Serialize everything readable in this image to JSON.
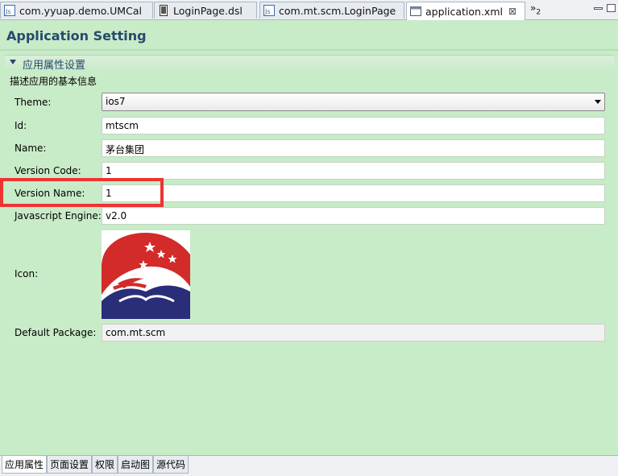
{
  "tabs": [
    {
      "label": "com.yyuap.demo.UMCal",
      "icon": "js-file-icon",
      "active": false
    },
    {
      "label": "LoginPage.dsl",
      "icon": "dsl-file-icon",
      "active": false
    },
    {
      "label": "com.mt.scm.LoginPage",
      "icon": "js-file-icon",
      "active": false
    },
    {
      "label": "application.xml",
      "icon": "xml-file-icon",
      "active": true,
      "close": "⊠"
    }
  ],
  "overflow": {
    "symbol": "»",
    "count": "2"
  },
  "form": {
    "title": "Application Setting",
    "section_title": "应用属性设置",
    "section_desc": "描述应用的基本信息",
    "fields": {
      "theme": {
        "label": "Theme:",
        "value": "ios7"
      },
      "id": {
        "label": "Id:",
        "value": "mtscm"
      },
      "name": {
        "label": "Name:",
        "value": "茅台集团"
      },
      "version_code": {
        "label": "Version Code:",
        "value": "1"
      },
      "version_name": {
        "label": "Version Name:",
        "value": "1"
      },
      "js_engine": {
        "label": "Javascript Engine:",
        "value": "v2.0"
      },
      "icon": {
        "label": "Icon:"
      },
      "default_package": {
        "label": "Default Package:",
        "value": "com.mt.scm"
      }
    }
  },
  "bottom_tabs": [
    {
      "label": "应用属性",
      "active": true
    },
    {
      "label": "页面设置",
      "active": false
    },
    {
      "label": "权限",
      "active": false
    },
    {
      "label": "启动图",
      "active": false
    },
    {
      "label": "源代码",
      "active": false
    }
  ],
  "colors": {
    "background": "#c8ebc8",
    "title": "#27496d",
    "highlight": "#ee3333"
  }
}
